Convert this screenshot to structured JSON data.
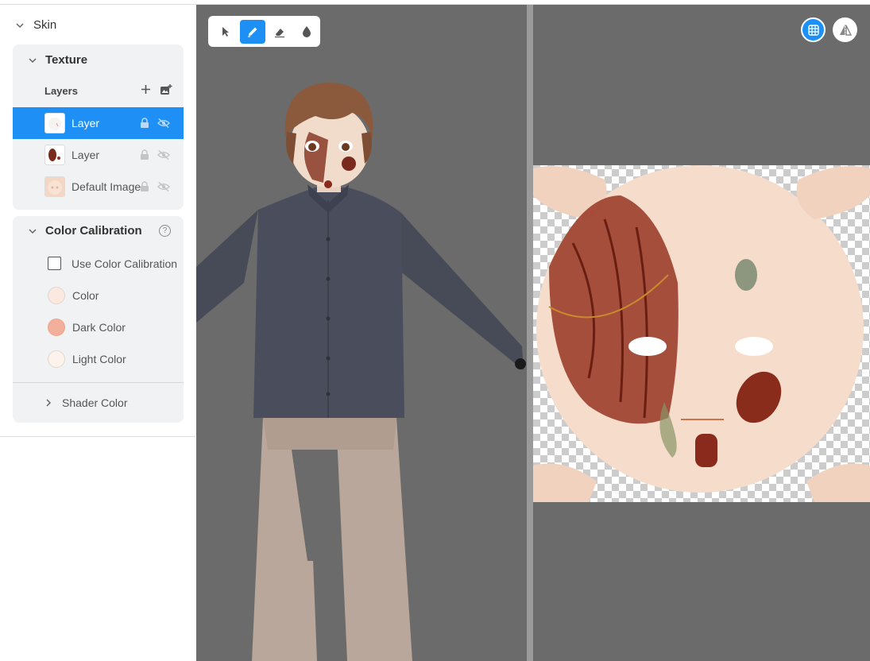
{
  "sidebar": {
    "skin_label": "Skin",
    "texture": {
      "title": "Texture",
      "layers_label": "Layers",
      "layers": [
        {
          "name": "Layer",
          "active": true
        },
        {
          "name": "Layer",
          "active": false
        },
        {
          "name": "Default Image",
          "active": false
        }
      ]
    },
    "calibration": {
      "title": "Color Calibration",
      "use_label": "Use Color Calibration",
      "colors": [
        {
          "label": "Color",
          "hex": "#fbe8de"
        },
        {
          "label": "Dark Color",
          "hex": "#f2b09a"
        },
        {
          "label": "Light Color",
          "hex": "#fdf2ec"
        }
      ],
      "shader_label": "Shader Color"
    }
  },
  "toolbar": {
    "tools": [
      "select-icon",
      "pen-icon",
      "eraser-icon",
      "fill-drop-icon"
    ],
    "active_tool": "pen-icon"
  },
  "view_buttons": [
    "grid-icon",
    "mirror-icon"
  ],
  "colors": {
    "accent": "#1e90f5",
    "viewport_bg": "#6b6b6b",
    "card_bg": "#f1f2f4"
  }
}
